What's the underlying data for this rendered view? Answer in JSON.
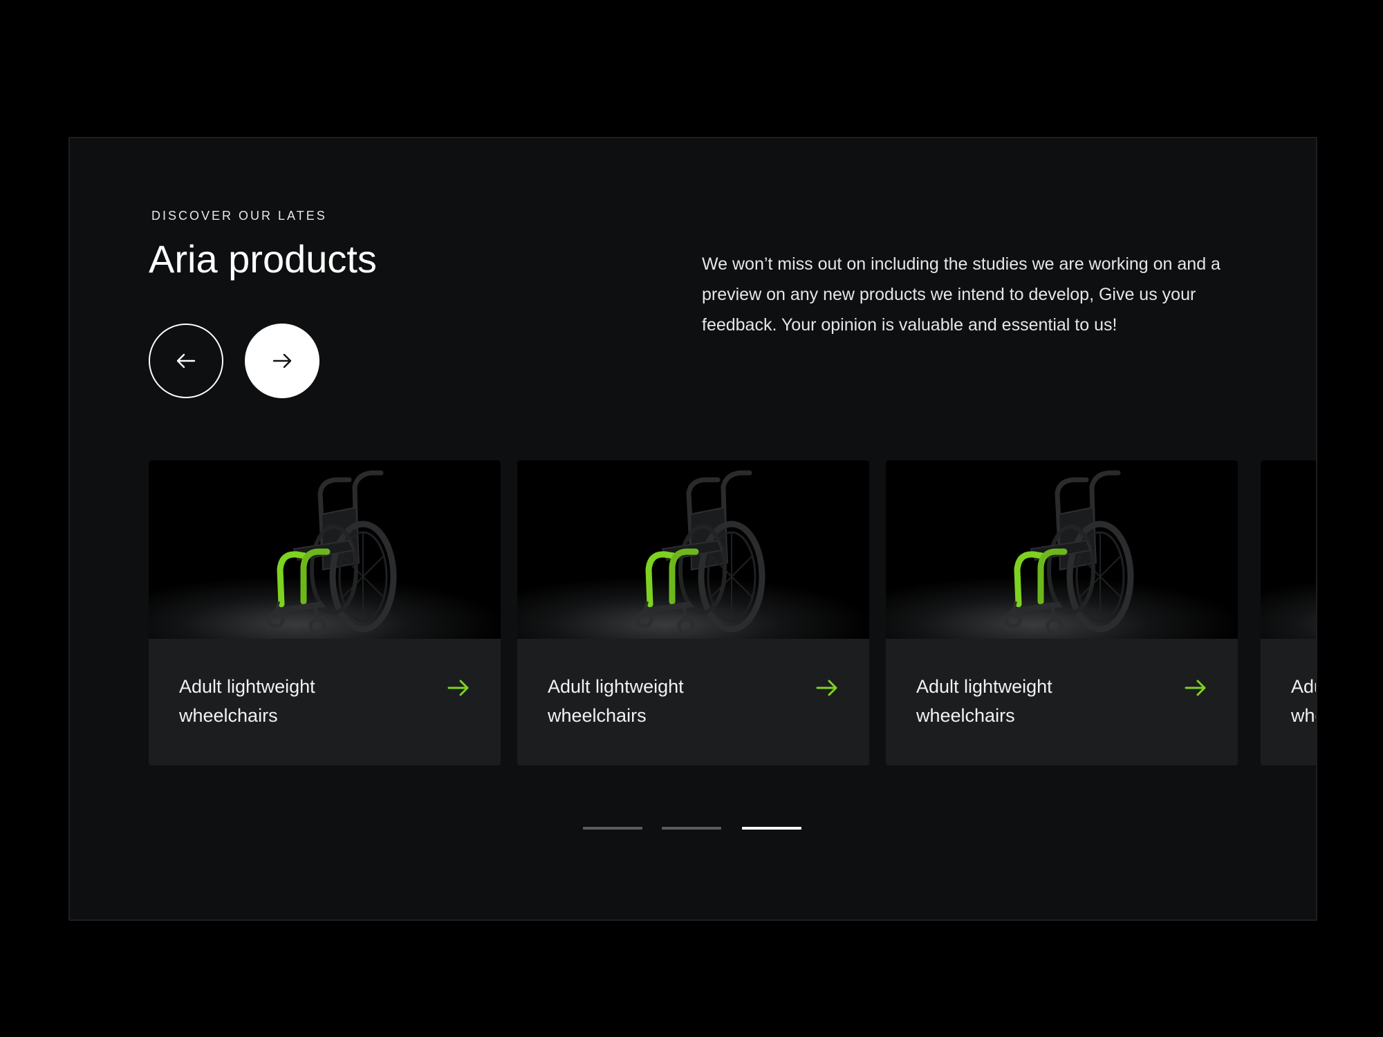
{
  "header": {
    "eyebrow": "DISCOVER OUR LATES",
    "title": "Aria products",
    "intro": "We won’t miss out on including the studies we are working on and a preview on any new products we intend to develop, Give us your feedback. Your opinion is valuable and essential to us!"
  },
  "nav": {
    "prev_icon": "arrow-left-icon",
    "next_icon": "arrow-right-icon"
  },
  "cards": [
    {
      "label": "Adult lightweight\nwheelchairs",
      "image": "wheelchair-image",
      "icon": "arrow-right-icon"
    },
    {
      "label": "Adult lightweight\nwheelchairs",
      "image": "wheelchair-image",
      "icon": "arrow-right-icon"
    },
    {
      "label": "Adult lightweight\nwheelchairs",
      "image": "wheelchair-image",
      "icon": "arrow-right-icon"
    },
    {
      "label": "Adult lightweight\nwheelchairs",
      "image": "wheelchair-image",
      "icon": "arrow-right-icon"
    }
  ],
  "pagination": {
    "count": 3,
    "active_index": 2
  },
  "colors": {
    "accent": "#7ed321",
    "panel": "#0e0f11",
    "card": "#1c1d1f",
    "dot_inactive": "#5a5b5e",
    "dot_active": "#ffffff"
  }
}
